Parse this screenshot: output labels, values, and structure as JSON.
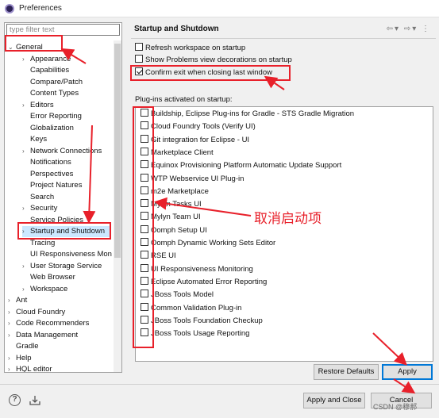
{
  "window": {
    "title": "Preferences"
  },
  "filter": {
    "placeholder": "type filter text"
  },
  "tree": {
    "general": "General",
    "general_children": [
      "Appearance",
      "Capabilities",
      "Compare/Patch",
      "Content Types",
      "Editors",
      "Error Reporting",
      "Globalization",
      "Keys",
      "Network Connections",
      "Notifications",
      "Perspectives",
      "Project Natures",
      "Search",
      "Security",
      "Service Policies",
      "Startup and Shutdown",
      "Tracing",
      "UI Responsiveness Mon",
      "User Storage Service",
      "Web Browser",
      "Workspace"
    ],
    "top_items": [
      "Ant",
      "Cloud Foundry",
      "Code Recommenders",
      "Data Management",
      "Gradle",
      "Help",
      "HQL editor"
    ]
  },
  "page": {
    "title": "Startup and Shutdown"
  },
  "options": {
    "refresh": "Refresh workspace on startup",
    "problems": "Show Problems view decorations on startup",
    "confirm": "Confirm exit when closing last window"
  },
  "plugins": {
    "label": "Plug-ins activated on startup:",
    "items": [
      "Buildship, Eclipse Plug-ins for Gradle - STS Gradle Migration",
      "Cloud Foundry Tools (Verify UI)",
      "Git integration for Eclipse - UI",
      "Marketplace Client",
      "Equinox Provisioning Platform Automatic Update Support",
      "WTP Webservice UI Plug-in",
      "m2e Marketplace",
      "Mylyn Tasks UI",
      "Mylyn Team UI",
      "Oomph Setup UI",
      "Oomph Dynamic Working Sets Editor",
      "RSE UI",
      "UI Responsiveness Monitoring",
      "Eclipse Automated Error Reporting",
      "JBoss Tools Model",
      "Common Validation Plug-in",
      "JBoss Tools Foundation Checkup",
      "JBoss Tools Usage Reporting"
    ]
  },
  "buttons": {
    "restore": "Restore Defaults",
    "apply": "Apply",
    "apply_close": "Apply and Close",
    "cancel": "Cancel"
  },
  "annotation": {
    "text": "取消启动项"
  },
  "watermark": "CSDN @穆郝"
}
